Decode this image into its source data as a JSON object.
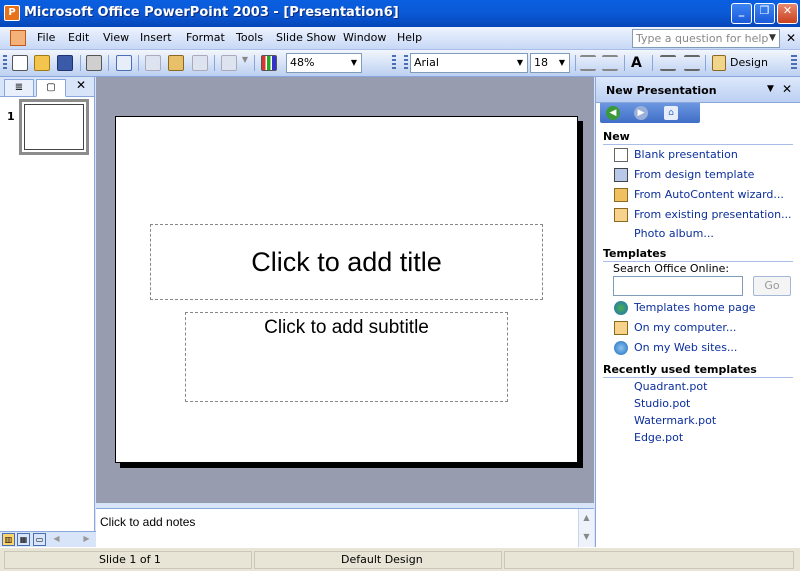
{
  "window": {
    "title": "Microsoft Office PowerPoint 2003 - [Presentation6]",
    "min_glyph": "_",
    "max_glyph": "❐",
    "close_glyph": "✕"
  },
  "menu": {
    "items": [
      "File",
      "Edit",
      "View",
      "Insert",
      "Format",
      "Tools",
      "Slide Show",
      "Window",
      "Help"
    ],
    "help_placeholder": "Type a question for help",
    "close_doc": "✕"
  },
  "toolbar": {
    "zoom": "48%",
    "font": "Arial",
    "font_size": "18",
    "design_label": "Design",
    "grow_font_glyph": "A"
  },
  "left_panel": {
    "tab_outline_glyph": "≣",
    "tab_slides_glyph": "▢",
    "close_glyph": "✕",
    "slide_number": "1"
  },
  "slide": {
    "title_placeholder": "Click to add title",
    "subtitle_placeholder": "Click to add subtitle"
  },
  "notes": {
    "placeholder": "Click to add notes"
  },
  "task_pane": {
    "title": "New Presentation",
    "sections": {
      "new": "New",
      "templates": "Templates",
      "recent": "Recently used templates"
    },
    "new_links": [
      "Blank presentation",
      "From design template",
      "From AutoContent wizard...",
      "From existing presentation...",
      "Photo album..."
    ],
    "search_label": "Search Office Online:",
    "go_label": "Go",
    "template_links": [
      "Templates home page",
      "On my computer...",
      "On my Web sites..."
    ],
    "recent_templates": [
      "Quadrant.pot",
      "Studio.pot",
      "Watermark.pot",
      "Edge.pot"
    ],
    "icons": [
      "blank-doc-icon",
      "design-template-icon",
      "autocontent-icon",
      "existing-presentation-icon"
    ],
    "nav_back": "◀",
    "nav_forward": "▶",
    "home_glyph": "⌂"
  },
  "status": {
    "slide_info": "Slide 1 of 1",
    "design": "Default Design"
  },
  "colors": {
    "title_bar": "#0b5ad8",
    "link": "#0b2e9b",
    "slide_bg": "#979daf"
  }
}
